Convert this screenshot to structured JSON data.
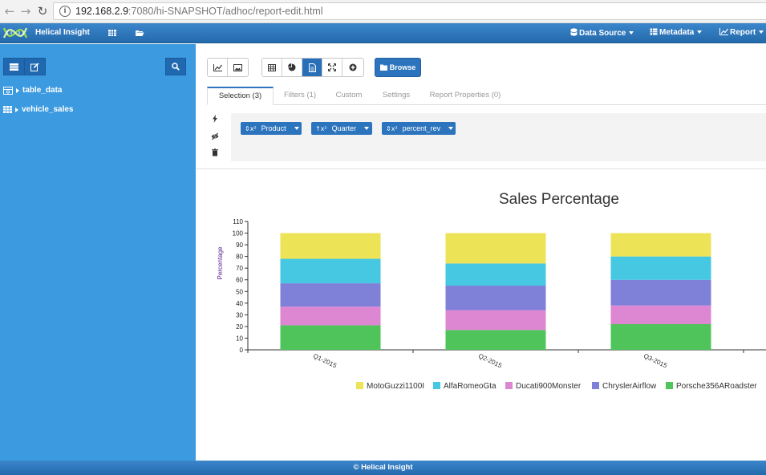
{
  "browser": {
    "url_host": "192.168.2.9",
    "url_rest": ":7080/hi-SNAPSHOT/adhoc/report-edit.html"
  },
  "navbar": {
    "brand": "Helical Insight",
    "menus": [
      {
        "label": "Data Source",
        "icon": "database-icon"
      },
      {
        "label": "Metadata",
        "icon": "table-icon"
      },
      {
        "label": "Report",
        "icon": "line-chart-icon"
      }
    ]
  },
  "sidebar": {
    "items": [
      {
        "label": "table_data",
        "icon": "table-data-icon"
      },
      {
        "label": "vehicle_sales",
        "icon": "grid-icon"
      }
    ]
  },
  "toolbar": {
    "browse_label": "Browse"
  },
  "tabs": [
    {
      "label": "Selection (3)",
      "active": true
    },
    {
      "label": "Filters (1)",
      "active": false
    },
    {
      "label": "Custom",
      "active": false
    },
    {
      "label": "Settings",
      "active": false
    },
    {
      "label": "Report Properties (0)",
      "active": false
    }
  ],
  "selection": {
    "fields": [
      {
        "label": "Product",
        "prefix": "x²"
      },
      {
        "label": "Quarter",
        "prefix": "x²"
      },
      {
        "label": "percent_rev",
        "prefix": "x²"
      }
    ]
  },
  "chart_data": {
    "type": "bar",
    "stacked": true,
    "title": "Sales Percentage",
    "xlabel": "",
    "ylabel": "Percentage",
    "ylim": [
      0,
      110
    ],
    "yticks": [
      0,
      10,
      20,
      30,
      40,
      50,
      60,
      70,
      80,
      90,
      100,
      110
    ],
    "categories": [
      "Q1-2015",
      "Q2-2015",
      "Q3-2015"
    ],
    "legend_position": "bottom-right",
    "series": [
      {
        "name": "Porsche356ARoadster",
        "color": "#4fc45a",
        "values": [
          21,
          17,
          22
        ]
      },
      {
        "name": "Ducati900Monster",
        "color": "#dd86d2",
        "values": [
          16,
          17,
          16
        ]
      },
      {
        "name": "ChryslerAirflow",
        "color": "#7f80d8",
        "values": [
          20,
          21,
          22
        ]
      },
      {
        "name": "AlfaRomeoGta",
        "color": "#46c8e2",
        "values": [
          21,
          19,
          20
        ]
      },
      {
        "name": "MotoGuzzi1100I",
        "color": "#ede357",
        "values": [
          22,
          26,
          20
        ]
      }
    ],
    "legend_order": [
      "MotoGuzzi1100I",
      "AlfaRomeoGta",
      "Ducati900Monster",
      "ChryslerAirflow",
      "Porsche356ARoadster"
    ]
  },
  "footer": {
    "text": "© Helical Insight"
  }
}
